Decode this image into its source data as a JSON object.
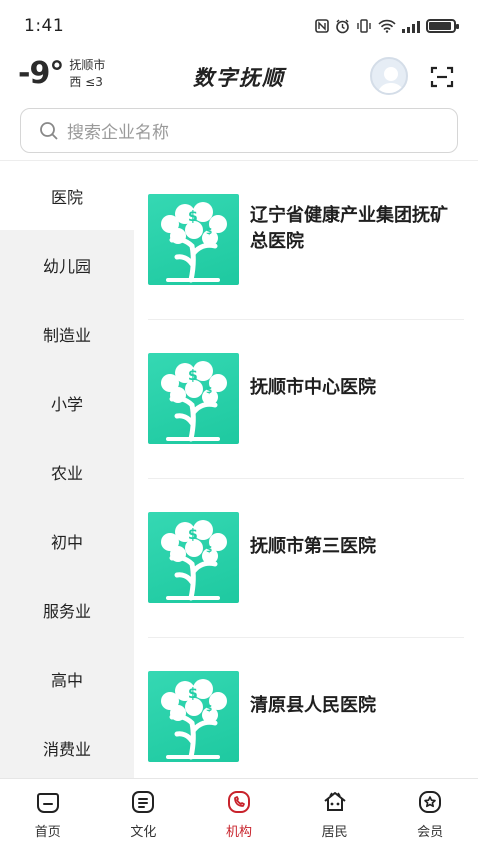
{
  "status_bar": {
    "time": "1:41",
    "icons": [
      "nfc-icon",
      "alarm-icon",
      "vibrate-icon",
      "wifi-icon",
      "signal-icon",
      "battery-icon"
    ],
    "battery_level": 0.9
  },
  "header": {
    "temperature": "-9°",
    "city": "抚顺市",
    "wind": "西 ≤3",
    "title": "数字抚顺"
  },
  "search": {
    "placeholder": "搜索企业名称"
  },
  "sidebar": {
    "items": [
      {
        "label": "医院",
        "active": true
      },
      {
        "label": "幼儿园",
        "active": false
      },
      {
        "label": "制造业",
        "active": false
      },
      {
        "label": "小学",
        "active": false
      },
      {
        "label": "农业",
        "active": false
      },
      {
        "label": "初中",
        "active": false
      },
      {
        "label": "服务业",
        "active": false
      },
      {
        "label": "高中",
        "active": false
      },
      {
        "label": "消费业",
        "active": false
      }
    ]
  },
  "organizations": [
    {
      "name": "辽宁省健康产业集团抚矿总医院"
    },
    {
      "name": "抚顺市中心医院"
    },
    {
      "name": "抚顺市第三医院"
    },
    {
      "name": "清原县人民医院"
    }
  ],
  "tabbar": {
    "tabs": [
      {
        "label": "首页",
        "icon": "home-icon",
        "active": false
      },
      {
        "label": "文化",
        "icon": "culture-icon",
        "active": false
      },
      {
        "label": "机构",
        "icon": "institution-icon",
        "active": true
      },
      {
        "label": "居民",
        "icon": "resident-icon",
        "active": false
      },
      {
        "label": "会员",
        "icon": "member-icon",
        "active": false
      }
    ]
  },
  "colors": {
    "accent": "#c8232c",
    "thumb_green": "#2ad3ab",
    "sidebar_bg": "#f2f2f2"
  }
}
